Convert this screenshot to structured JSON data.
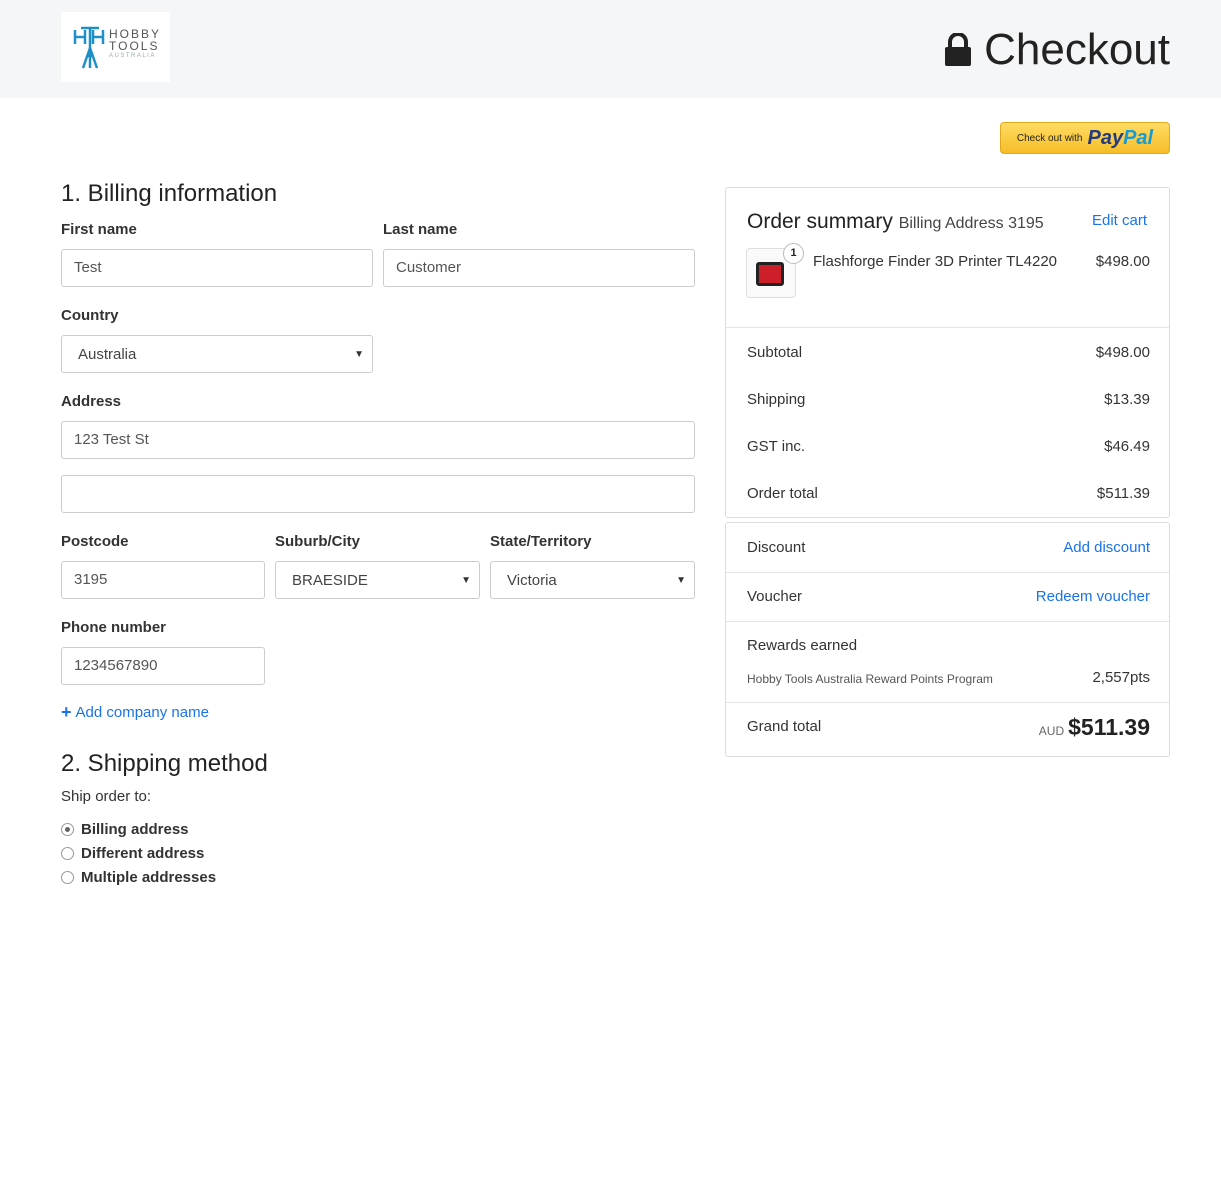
{
  "header": {
    "logo_line1": "HOBBY",
    "logo_line2": "TOOLS",
    "logo_line3": "AUSTRALIA",
    "title": "Checkout"
  },
  "paypal": {
    "prefix": "Check out with",
    "brand1": "Pay",
    "brand2": "Pal"
  },
  "billing": {
    "heading": "1. Billing information",
    "first_name_label": "First name",
    "first_name_value": "Test",
    "last_name_label": "Last name",
    "last_name_value": "Customer",
    "country_label": "Country",
    "country_value": "Australia",
    "address_label": "Address",
    "address1_value": "123 Test St",
    "address2_value": "",
    "postcode_label": "Postcode",
    "postcode_value": "3195",
    "suburb_label": "Suburb/City",
    "suburb_value": "BRAESIDE",
    "state_label": "State/Territory",
    "state_value": "Victoria",
    "phone_label": "Phone number",
    "phone_value": "1234567890",
    "add_company": "Add company name"
  },
  "shipping": {
    "heading": "2. Shipping method",
    "ship_to": "Ship order to:",
    "options": [
      {
        "label": "Billing address",
        "checked": true
      },
      {
        "label": "Different address",
        "checked": false
      },
      {
        "label": "Multiple addresses",
        "checked": false
      }
    ]
  },
  "summary": {
    "title": "Order summary",
    "billing_address": "Billing Address 3195",
    "edit_cart": "Edit cart",
    "item": {
      "qty": "1",
      "name": "Flashforge Finder 3D Printer TL4220",
      "price": "$498.00"
    },
    "subtotal_label": "Subtotal",
    "subtotal": "$498.00",
    "shipping_label": "Shipping",
    "shipping": "$13.39",
    "gst_label": "GST inc.",
    "gst": "$46.49",
    "order_total_label": "Order total",
    "order_total": "$511.39"
  },
  "extras": {
    "discount_label": "Discount",
    "discount_link": "Add discount",
    "voucher_label": "Voucher",
    "voucher_link": "Redeem voucher",
    "rewards_label": "Rewards earned",
    "rewards_program": "Hobby Tools Australia Reward Points Program",
    "rewards_points": "2,557pts",
    "grand_label": "Grand total",
    "currency": "AUD",
    "grand_total": "$511.39"
  }
}
